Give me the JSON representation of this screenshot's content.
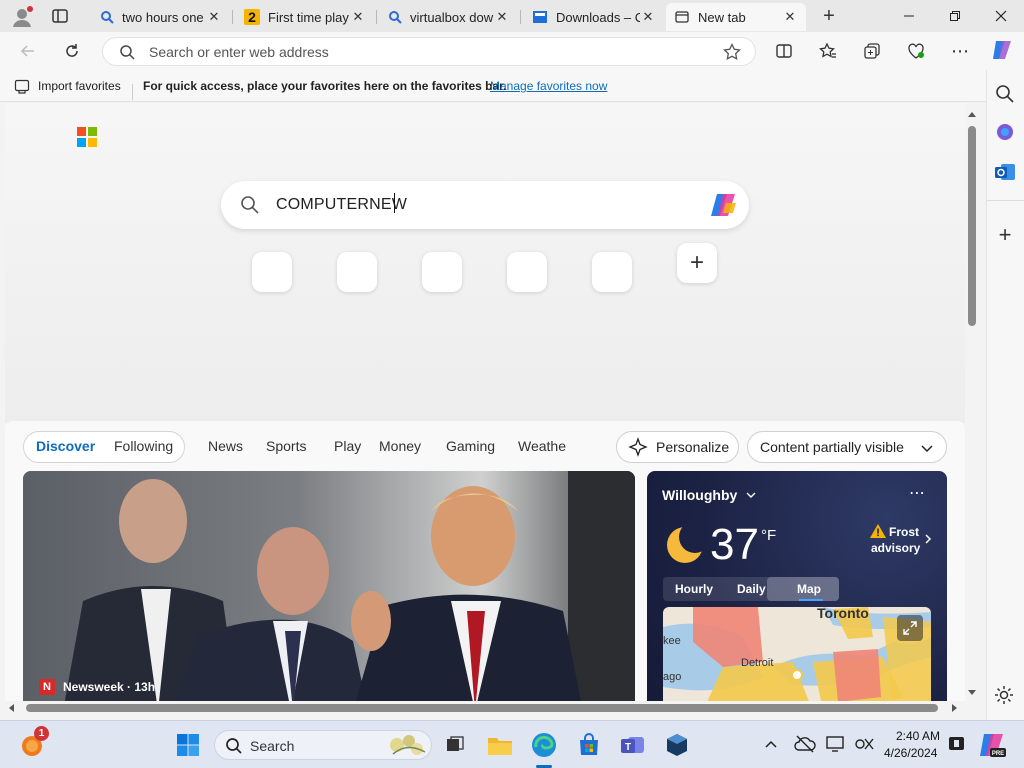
{
  "tabs": [
    {
      "title": "two hours one",
      "icon": "search-icon"
    },
    {
      "title": "First time play",
      "icon": "app-2-icon"
    },
    {
      "title": "virtualbox dow",
      "icon": "search-icon"
    },
    {
      "title": "Downloads – C",
      "icon": "downloads-page-icon"
    },
    {
      "title": "New tab",
      "icon": "new-tab-icon"
    }
  ],
  "address_bar": {
    "placeholder": "Search or enter web address"
  },
  "favorites_bar": {
    "import_label": "Import favorites",
    "hint": "For quick access, place your favorites here on the favorites bar.",
    "manage_link": "Manage favorites now"
  },
  "newtab": {
    "search_value": "COMPUTERNEW",
    "add_shortcut": "+"
  },
  "feed": {
    "tabs": [
      "Discover",
      "Following",
      "News",
      "Sports",
      "Play",
      "Money",
      "Gaming",
      "Weathe"
    ],
    "personalize_label": "Personalize",
    "content_label": "Content partially visible",
    "news": {
      "source": "Newsweek",
      "age": "13h",
      "source_line": "Newsweek · 13h"
    }
  },
  "weather": {
    "location": "Willoughby",
    "temperature": "37",
    "unit": "°F",
    "alert_line1": "Frost",
    "alert_line2": "advisory",
    "tabs": [
      "Hourly",
      "Daily",
      "Map"
    ],
    "active_tab": "Map",
    "map_labels": [
      "Toronto",
      "Detroit",
      "kee",
      "ago"
    ]
  },
  "taskbar": {
    "search_placeholder": "Search",
    "time": "2:40 AM",
    "date": "4/26/2024",
    "notification_count": "1"
  },
  "colors": {
    "accent": "#0f6cbd",
    "link": "#0f6cbd",
    "weather_bg": "#1c2244",
    "taskbar_bg": "#dfe6f2"
  }
}
